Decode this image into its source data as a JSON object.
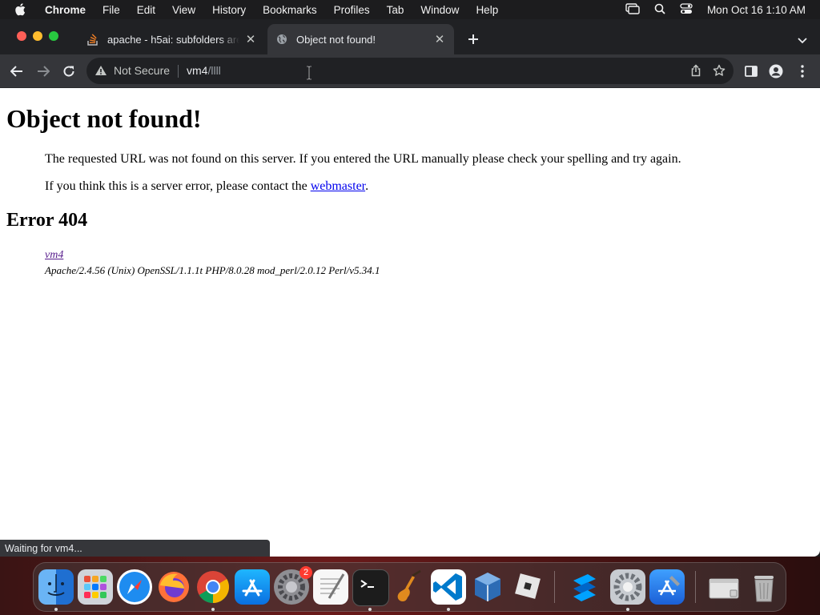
{
  "menubar": {
    "app": "Chrome",
    "items": [
      "File",
      "Edit",
      "View",
      "History",
      "Bookmarks",
      "Profiles",
      "Tab",
      "Window",
      "Help"
    ],
    "clock": "Mon Oct 16  1:10 AM"
  },
  "tabs": [
    {
      "title": "apache - h5ai: subfolders are",
      "icon": "stack-overflow-icon",
      "active": false
    },
    {
      "title": "Object not found!",
      "icon": "globe-icon",
      "active": true
    }
  ],
  "toolbar": {
    "security_label": "Not Secure",
    "url_host": "vm4",
    "url_path": "/llll"
  },
  "page": {
    "title": "Object not found!",
    "paragraph1": "The requested URL was not found on this server. If you entered the URL manually please check your spelling and try again.",
    "paragraph2_prefix": "If you think this is a server error, please contact the ",
    "paragraph2_link": "webmaster",
    "paragraph2_suffix": ".",
    "error_heading": "Error 404",
    "address_link": "vm4",
    "server_signature": "Apache/2.4.56 (Unix) OpenSSL/1.1.1t PHP/8.0.28 mod_perl/2.0.12 Perl/v5.34.1"
  },
  "status_bar": "Waiting for vm4...",
  "dock": {
    "apps": [
      {
        "name": "finder-icon",
        "running": true,
        "color": "#2d8cf0"
      },
      {
        "name": "launchpad-icon",
        "running": false,
        "color": "#d9dde3"
      },
      {
        "name": "safari-icon",
        "running": false,
        "color": "#1e90ff"
      },
      {
        "name": "firefox-icon",
        "running": false,
        "color": "#ff7139"
      },
      {
        "name": "chrome-icon",
        "running": true,
        "color": "#4285f4"
      },
      {
        "name": "app-store-icon",
        "running": false,
        "color": "#1a8cff"
      },
      {
        "name": "system-settings-icon",
        "running": false,
        "color": "#8e8e93",
        "badge": "2"
      },
      {
        "name": "textedit-icon",
        "running": false,
        "color": "#f5f5f5"
      },
      {
        "name": "terminal-icon",
        "running": true,
        "color": "#1c1c1c"
      },
      {
        "name": "garageband-icon",
        "running": false,
        "color": "#f29c1f"
      },
      {
        "name": "vscode-icon",
        "running": true,
        "color": "#007acc"
      },
      {
        "name": "virtualbox-icon",
        "running": false,
        "color": "#1c5fa8"
      },
      {
        "name": "roblox-icon",
        "running": false,
        "color": "#e2e2e2"
      },
      {
        "name": "roblox-studio-icon",
        "running": false,
        "color": "#00a2ff"
      },
      {
        "name": "settings-gear-icon",
        "running": true,
        "color": "#9ea5ad"
      },
      {
        "name": "xcode-icon",
        "running": false,
        "color": "#1d7cf2"
      },
      {
        "name": "downloads-stack-icon",
        "running": false,
        "color": "#dcdcdc"
      },
      {
        "name": "trash-icon",
        "running": false,
        "color": "#b8b8b8"
      }
    ]
  }
}
